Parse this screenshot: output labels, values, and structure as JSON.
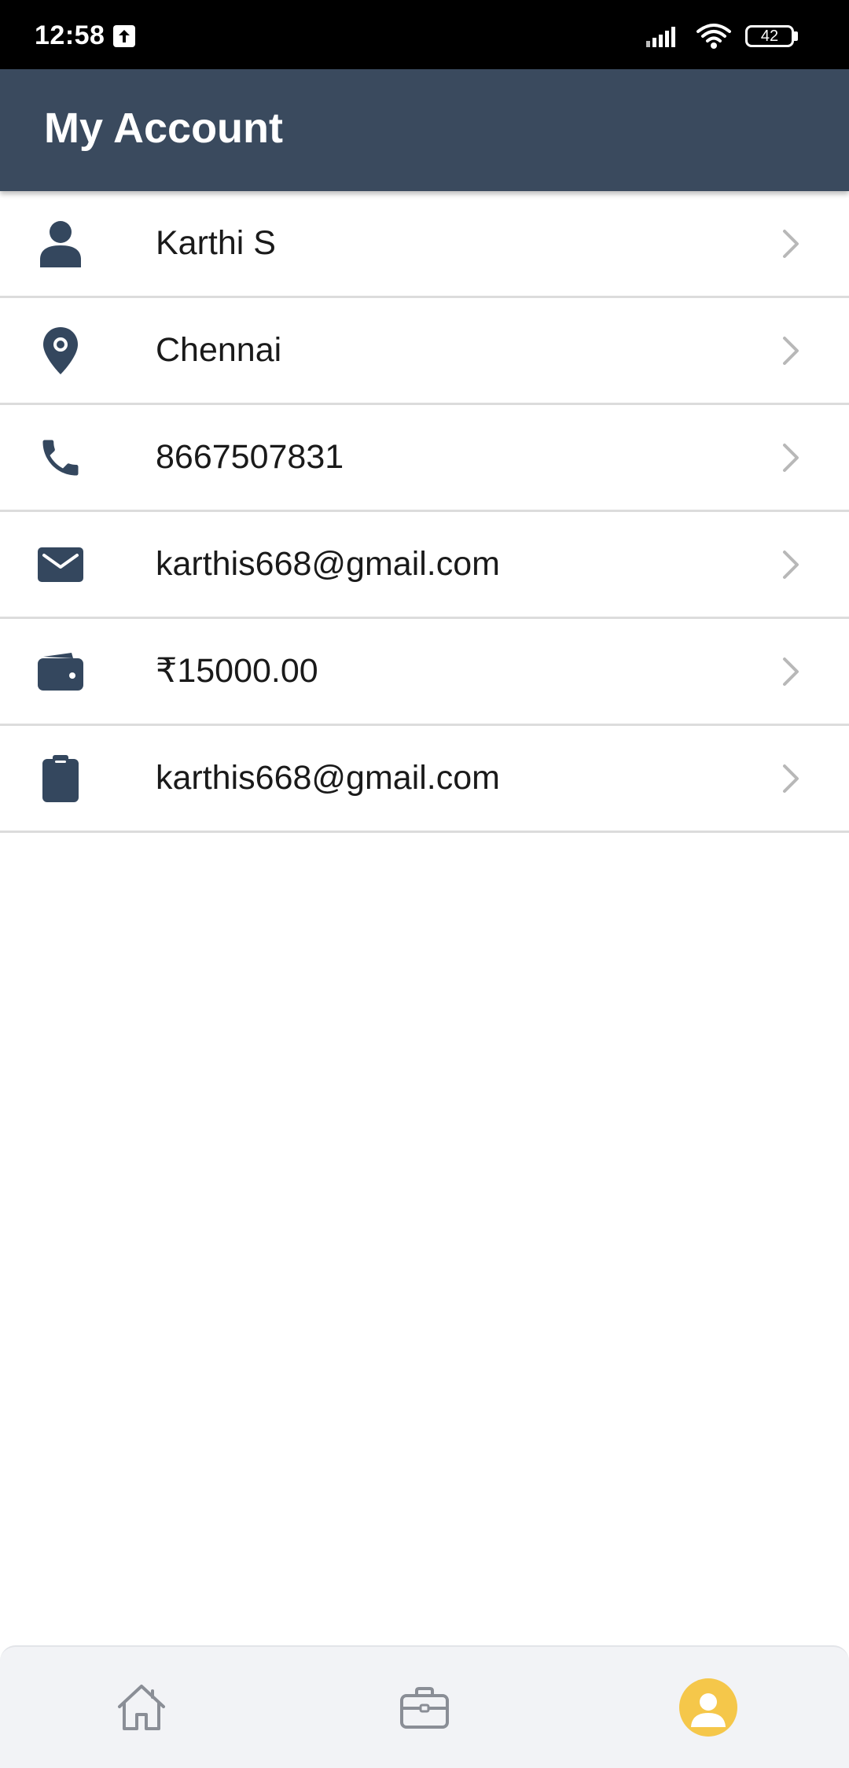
{
  "status_bar": {
    "time": "12:58",
    "battery": "42"
  },
  "header": {
    "title": "My Account"
  },
  "account_items": [
    {
      "icon": "person-icon",
      "value": "Karthi S"
    },
    {
      "icon": "location-pin-icon",
      "value": "Chennai"
    },
    {
      "icon": "phone-icon",
      "value": "8667507831"
    },
    {
      "icon": "envelope-icon",
      "value": "karthis668@gmail.com"
    },
    {
      "icon": "wallet-icon",
      "value": "₹15000.00"
    },
    {
      "icon": "clipboard-icon",
      "value": "karthis668@gmail.com"
    }
  ],
  "bottom_nav": {
    "items": [
      {
        "icon": "home-icon",
        "active": false
      },
      {
        "icon": "briefcase-icon",
        "active": false
      },
      {
        "icon": "account-icon",
        "active": true
      }
    ],
    "active_color": "#f5c74a"
  },
  "colors": {
    "app_bar": "#3a4a5e",
    "icon": "#34475e",
    "divider": "#dcdcdc"
  }
}
